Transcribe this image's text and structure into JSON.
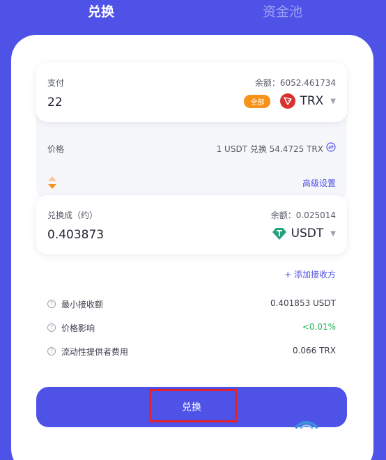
{
  "tabs": [
    {
      "label": "兑换",
      "active": true
    },
    {
      "label": "资金池",
      "active": false
    }
  ],
  "pay": {
    "label": "支付",
    "balance": "余额：6052.461734",
    "amount": "22",
    "all_label": "全部",
    "token": "TRX",
    "token_icon": "tron-icon"
  },
  "price": {
    "label": "价格",
    "value": "1 USDT 兑换 54.4725 TRX"
  },
  "advanced_label": "高级设置",
  "receive": {
    "label": "兑换成（约）",
    "balance": "余额：0.025014",
    "amount": "0.403873",
    "token": "USDT",
    "token_icon": "tether-icon"
  },
  "add_recipient_label": "+ 添加接收方",
  "info": [
    {
      "key": "最小接收额",
      "value": "0.401853 USDT"
    },
    {
      "key": "价格影响",
      "value": "<0.01%"
    },
    {
      "key": "流动性提供者费用",
      "value": "0.066 TRX"
    }
  ],
  "swap_button_label": "兑换",
  "colors": {
    "accent": "#4f52e6",
    "tron_red": "#d9312e",
    "tether_green": "#26a17b",
    "all_orange": "#f7931a",
    "impact_green": "#27b35c",
    "highlight_red": "#e3222b"
  }
}
